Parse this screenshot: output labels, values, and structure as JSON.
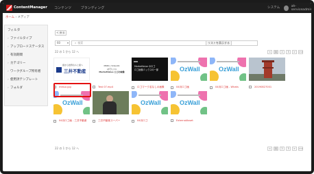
{
  "app": {
    "name": "ContentManager",
    "nav": [
      "コンテンツ",
      "ブランディング"
    ],
    "system": "システム",
    "user": "ah-serviceadmin"
  },
  "breadcrumb": {
    "home": "ホーム",
    "sep": " › ",
    "current": "メディア"
  },
  "sidebar": {
    "title": "フィルタ",
    "items": [
      {
        "label": "ファイルタイプ"
      },
      {
        "label": "アップロードステータス"
      },
      {
        "label": "有効期間"
      },
      {
        "label": "カテゴリー"
      },
      {
        "label": "ワークグループ所有者"
      },
      {
        "label": "使用済テンプレート"
      },
      {
        "label": "フォルダ"
      }
    ]
  },
  "toolbar": {
    "back_label": "< 戻る",
    "per_page": "60",
    "search_placeholder": "検索",
    "list_button": "リストを表示する"
  },
  "summary": {
    "top": "22 の 1 から 12 へ",
    "bottom": "22 の 1 から 12 へ"
  },
  "pager": [
    "<",
    "1",
    "2",
    "3",
    ">",
    ">>"
  ],
  "media": [
    {
      "name": "mitsui.jpg",
      "type": "mitsui"
    },
    {
      "name": "Test 07.mp4",
      "type": "video"
    },
    {
      "name": "ロゴマーク名なしの画像",
      "type": "dark"
    },
    {
      "name": "04月ロゴ画",
      "type": "ozwall"
    },
    {
      "name": "04月ロゴ画 - Whats",
      "type": "ozwall"
    },
    {
      "name": "20190827001",
      "type": "tower"
    },
    {
      "name": "04月ロゴ画 - 三井不動産",
      "type": "ozwall"
    },
    {
      "name": "三井不動産スーパー",
      "type": "person"
    },
    {
      "name": "04月ロゴ",
      "type": "ozwall"
    },
    {
      "name": "ExternalAsset",
      "type": "ozwall"
    }
  ],
  "thumb_text": {
    "mitsui_top": "街から世界の人と街へ",
    "mitsui_brand": "三井不動産",
    "video_lines": [
      "MORI | Video01",
      "(ポラリス)",
      "MarketValue ロゴの映像"
    ],
    "dark_lines": [
      "MarketValue のロゴ",
      "ロゴ画像ミックスの一部"
    ],
    "ozwall": "OzWall"
  },
  "colors": {
    "accent": "#d11a1a",
    "highlight": "#e31010",
    "ozwall_text": "#3aa0d8"
  }
}
